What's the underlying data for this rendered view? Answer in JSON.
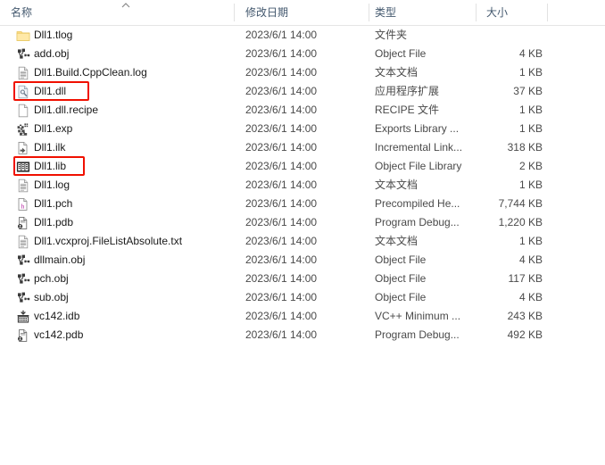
{
  "window": {
    "type": "windows-file-explorer-details-view"
  },
  "columns": {
    "name": "名称",
    "date_modified": "修改日期",
    "type": "类型",
    "size": "大小",
    "sort_column": "名称",
    "sort_direction": "ascending",
    "sort_icon": "chevron-up-icon"
  },
  "files": [
    {
      "name": "Dll1.tlog",
      "date": "2023/6/1 14:00",
      "type": "文件夹",
      "size": "",
      "icon": "folder-icon"
    },
    {
      "name": "add.obj",
      "date": "2023/6/1 14:00",
      "type": "Object File",
      "size": "4 KB",
      "icon": "obj-file-icon"
    },
    {
      "name": "Dll1.Build.CppClean.log",
      "date": "2023/6/1 14:00",
      "type": "文本文档",
      "size": "1 KB",
      "icon": "text-document-icon"
    },
    {
      "name": "Dll1.dll",
      "date": "2023/6/1 14:00",
      "type": "应用程序扩展",
      "size": "37 KB",
      "icon": "dll-file-icon"
    },
    {
      "name": "Dll1.dll.recipe",
      "date": "2023/6/1 14:00",
      "type": "RECIPE 文件",
      "size": "1 KB",
      "icon": "blank-document-icon"
    },
    {
      "name": "Dll1.exp",
      "date": "2023/6/1 14:00",
      "type": "Exports Library ...",
      "size": "1 KB",
      "icon": "exports-library-icon"
    },
    {
      "name": "Dll1.ilk",
      "date": "2023/6/1 14:00",
      "type": "Incremental Link...",
      "size": "318 KB",
      "icon": "incremental-link-icon"
    },
    {
      "name": "Dll1.lib",
      "date": "2023/6/1 14:00",
      "type": "Object File Library",
      "size": "2 KB",
      "icon": "library-file-icon"
    },
    {
      "name": "Dll1.log",
      "date": "2023/6/1 14:00",
      "type": "文本文档",
      "size": "1 KB",
      "icon": "text-document-icon"
    },
    {
      "name": "Dll1.pch",
      "date": "2023/6/1 14:00",
      "type": "Precompiled He...",
      "size": "7,744 KB",
      "icon": "precompiled-header-icon"
    },
    {
      "name": "Dll1.pdb",
      "date": "2023/6/1 14:00",
      "type": "Program Debug...",
      "size": "1,220 KB",
      "icon": "program-database-icon"
    },
    {
      "name": "Dll1.vcxproj.FileListAbsolute.txt",
      "date": "2023/6/1 14:00",
      "type": "文本文档",
      "size": "1 KB",
      "icon": "text-document-icon"
    },
    {
      "name": "dllmain.obj",
      "date": "2023/6/1 14:00",
      "type": "Object File",
      "size": "4 KB",
      "icon": "obj-file-icon"
    },
    {
      "name": "pch.obj",
      "date": "2023/6/1 14:00",
      "type": "Object File",
      "size": "117 KB",
      "icon": "obj-file-icon"
    },
    {
      "name": "sub.obj",
      "date": "2023/6/1 14:00",
      "type": "Object File",
      "size": "4 KB",
      "icon": "obj-file-icon"
    },
    {
      "name": "vc142.idb",
      "date": "2023/6/1 14:00",
      "type": "VC++ Minimum ...",
      "size": "243 KB",
      "icon": "idb-file-icon"
    },
    {
      "name": "vc142.pdb",
      "date": "2023/6/1 14:00",
      "type": "Program Debug...",
      "size": "492 KB",
      "icon": "program-database-icon"
    }
  ],
  "annotations": {
    "color": "#f01000",
    "boxes": [
      {
        "target": "Dll1.dll",
        "row_index": 3
      },
      {
        "target": "Dll1.lib",
        "row_index": 7
      }
    ]
  }
}
